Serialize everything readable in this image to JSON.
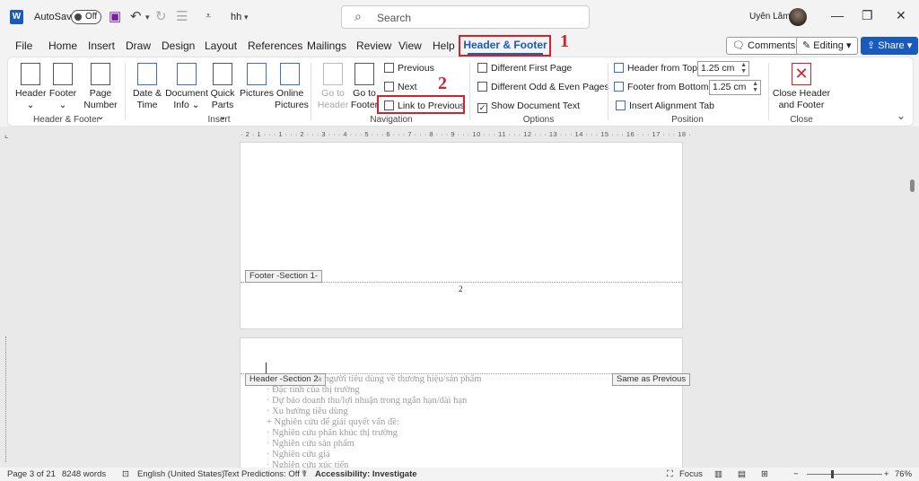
{
  "titlebar": {
    "app_icon": "W",
    "autosave_label": "AutoSave",
    "autosave_state": "Off",
    "doc_title": "hh",
    "search_placeholder": "Search",
    "user_name": "Uyên Lâm"
  },
  "tabs": [
    "File",
    "Home",
    "Insert",
    "Draw",
    "Design",
    "Layout",
    "References",
    "Mailings",
    "Review",
    "View",
    "Help"
  ],
  "active_tab": "Header & Footer",
  "title_buttons": {
    "comments": "Comments",
    "editing": "Editing",
    "share": "Share"
  },
  "annotations": {
    "first": "1",
    "second": "2"
  },
  "ribbon": {
    "header_footer_group": {
      "label": "Header & Footer",
      "header": "Header",
      "footer": "Footer",
      "page_number_line1": "Page",
      "page_number_line2": "Number"
    },
    "insert_group": {
      "label": "Insert",
      "date_time_line1": "Date &",
      "date_time_line2": "Time",
      "doc_info_line1": "Document",
      "doc_info_line2": "Info",
      "quick_parts_line1": "Quick",
      "quick_parts_line2": "Parts",
      "pictures": "Pictures",
      "online_pictures_line1": "Online",
      "online_pictures_line2": "Pictures"
    },
    "navigation_group": {
      "label": "Navigation",
      "goto_header_line1": "Go to",
      "goto_header_line2": "Header",
      "goto_footer_line1": "Go to",
      "goto_footer_line2": "Footer",
      "previous": "Previous",
      "next": "Next",
      "link_to_previous": "Link to Previous"
    },
    "options_group": {
      "label": "Options",
      "different_first_page": "Different First Page",
      "different_odd_even": "Different Odd & Even Pages",
      "show_document_text": "Show Document Text"
    },
    "position_group": {
      "label": "Position",
      "header_from_top": "Header from Top:",
      "header_from_top_value": "1.25 cm",
      "footer_from_bottom": "Footer from Bottom:",
      "footer_from_bottom_value": "1.25 cm",
      "insert_alignment_tab": "Insert Alignment Tab"
    },
    "close_group": {
      "label": "Close",
      "close_line1": "Close Header",
      "close_line2": "and Footer"
    }
  },
  "ruler_text": "· 2 · 1 · · · 1 · · · 2 · · · 3 · · · 4 · · · 5 · · · 6 · · · 7 · · · 8 · · · 9 · · · 10 · · · 11 · · · 12 · · · 13 · · · 14 · · · 15 · · · 16 · · · 17 · · · 18 ·",
  "document": {
    "footer_tag": "Footer -Section 1-",
    "page_number": "2",
    "header_tag": "Header -Section 2-",
    "same_as_previous": "Same as Previous",
    "body_lines": [
      "ia người tiêu dùng về thương hiệu/sản phẩm",
      "·   Đặc tính của thị trường",
      "·   Dự báo doanh thu/lợi nhuận trong ngắn hạn/dài hạn",
      "·   Xu hướng tiêu dùng",
      "+ Nghiên cứu để giải quyết vấn đề:",
      "·   Nghiên cứu phân khúc thị trường",
      "·   Nghiên cứu sản phẩm",
      "·   Nghiên cứu giá",
      "·   Nghiên cứu xúc tiến"
    ]
  },
  "statusbar": {
    "page": "Page 3 of 21",
    "words": "8248 words",
    "language": "English (United States)",
    "text_predictions": "Text Predictions: Off",
    "accessibility": "Accessibility: Investigate",
    "focus": "Focus",
    "zoom": "76%"
  }
}
